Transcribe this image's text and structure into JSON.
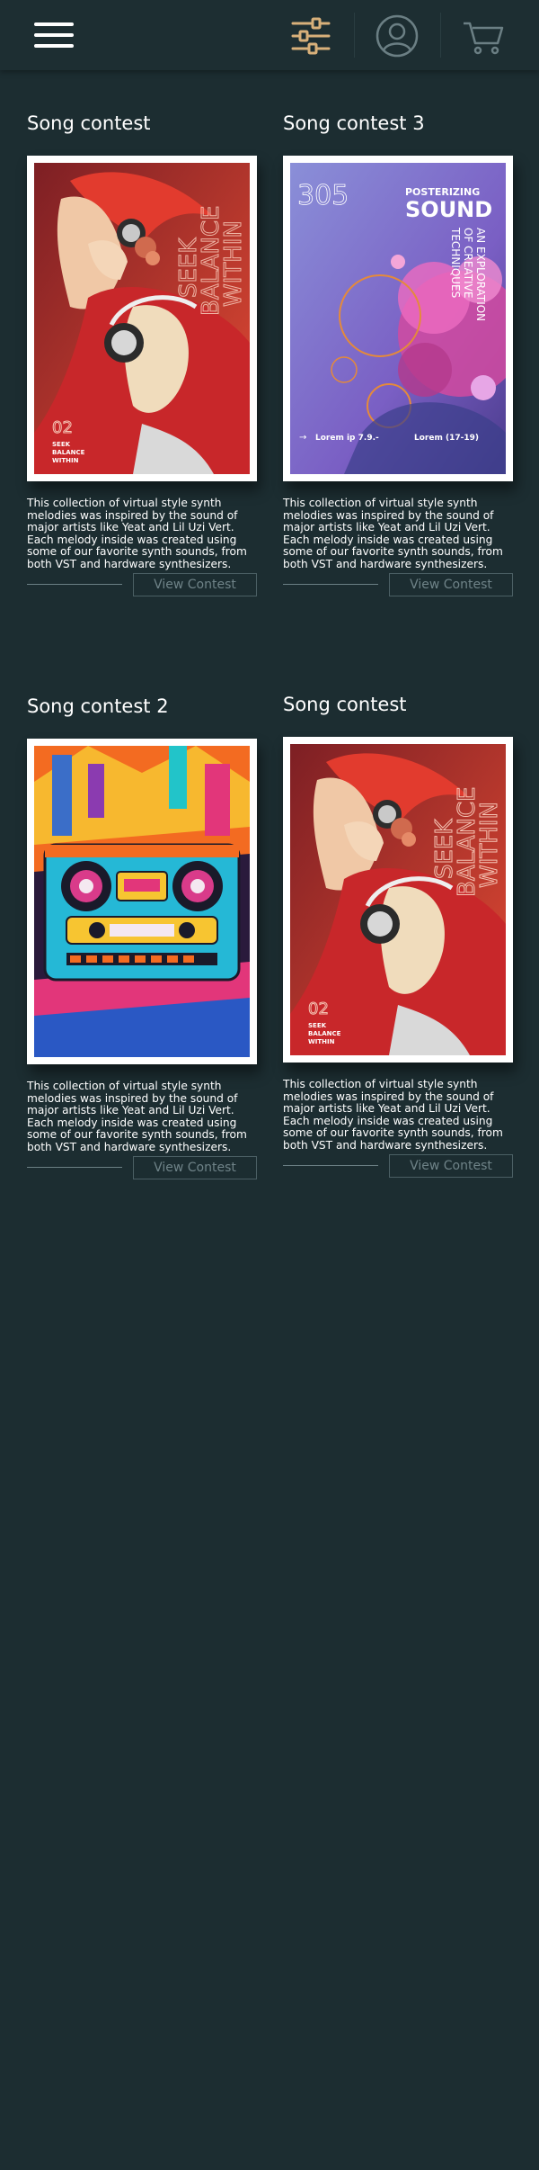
{
  "header": {
    "menu_icon": "hamburger-menu-icon",
    "filter_icon": "sliders-icon",
    "profile_icon": "user-avatar-icon",
    "cart_icon": "shopping-cart-icon",
    "colors": {
      "filter": "#d8b07a",
      "muted": "#6b7f84",
      "white": "#ffffff"
    }
  },
  "cards": [
    {
      "title": "Song contest",
      "poster": {
        "type": "woman-headphones",
        "big_text": [
          "SEEK",
          "BALANCE",
          "WITHIN"
        ],
        "number": "02",
        "small_text": [
          "SEEK",
          "BALANCE",
          "WITHIN"
        ]
      },
      "description": [
        "This collection of virtual style synth melodies was inspired by the sound of major artists like Yeat and Lil Uzi Vert.",
        "Each melody inside was created using some of our favorite synth sounds, from both VST and hardware synthesizers."
      ],
      "button": "View Contest"
    },
    {
      "title": "Song contest 3",
      "poster": {
        "type": "posterizing",
        "number": "305",
        "headline_small": "POSTERIZING",
        "headline_big": "SOUND",
        "vertical": [
          "AN EXPLORATION",
          "OF CREATIVE",
          "TECHNIQUES"
        ],
        "footer_left": "Lorem ip 7.9.-",
        "footer_right": "Lorem (17-19)"
      },
      "description": [
        "This collection of virtual style synth melodies was inspired by the sound of major artists like Yeat and Lil Uzi Vert.",
        "Each melody inside was created using some of our favorite synth sounds, from both VST and hardware synthesizers."
      ],
      "button": "View Contest"
    },
    {
      "title": "Song contest 2",
      "poster": {
        "type": "boombox"
      },
      "description": [
        "This collection of virtual style synth melodies was inspired by the sound of major artists like Yeat and Lil Uzi Vert.",
        "Each melody inside was created using some of our favorite synth sounds, from both VST and hardware synthesizers."
      ],
      "button": "View Contest"
    },
    {
      "title": "Song contest",
      "poster": {
        "type": "woman-headphones",
        "big_text": [
          "SEEK",
          "BALANCE",
          "WITHIN"
        ],
        "number": "02",
        "small_text": [
          "SEEK",
          "BALANCE",
          "WITHIN"
        ]
      },
      "description": [
        "This collection of virtual style synth melodies was inspired by the sound of major artists like Yeat and Lil Uzi Vert.",
        "Each melody inside was created using some of our favorite synth sounds, from both VST and hardware synthesizers."
      ],
      "button": "View Contest"
    }
  ]
}
